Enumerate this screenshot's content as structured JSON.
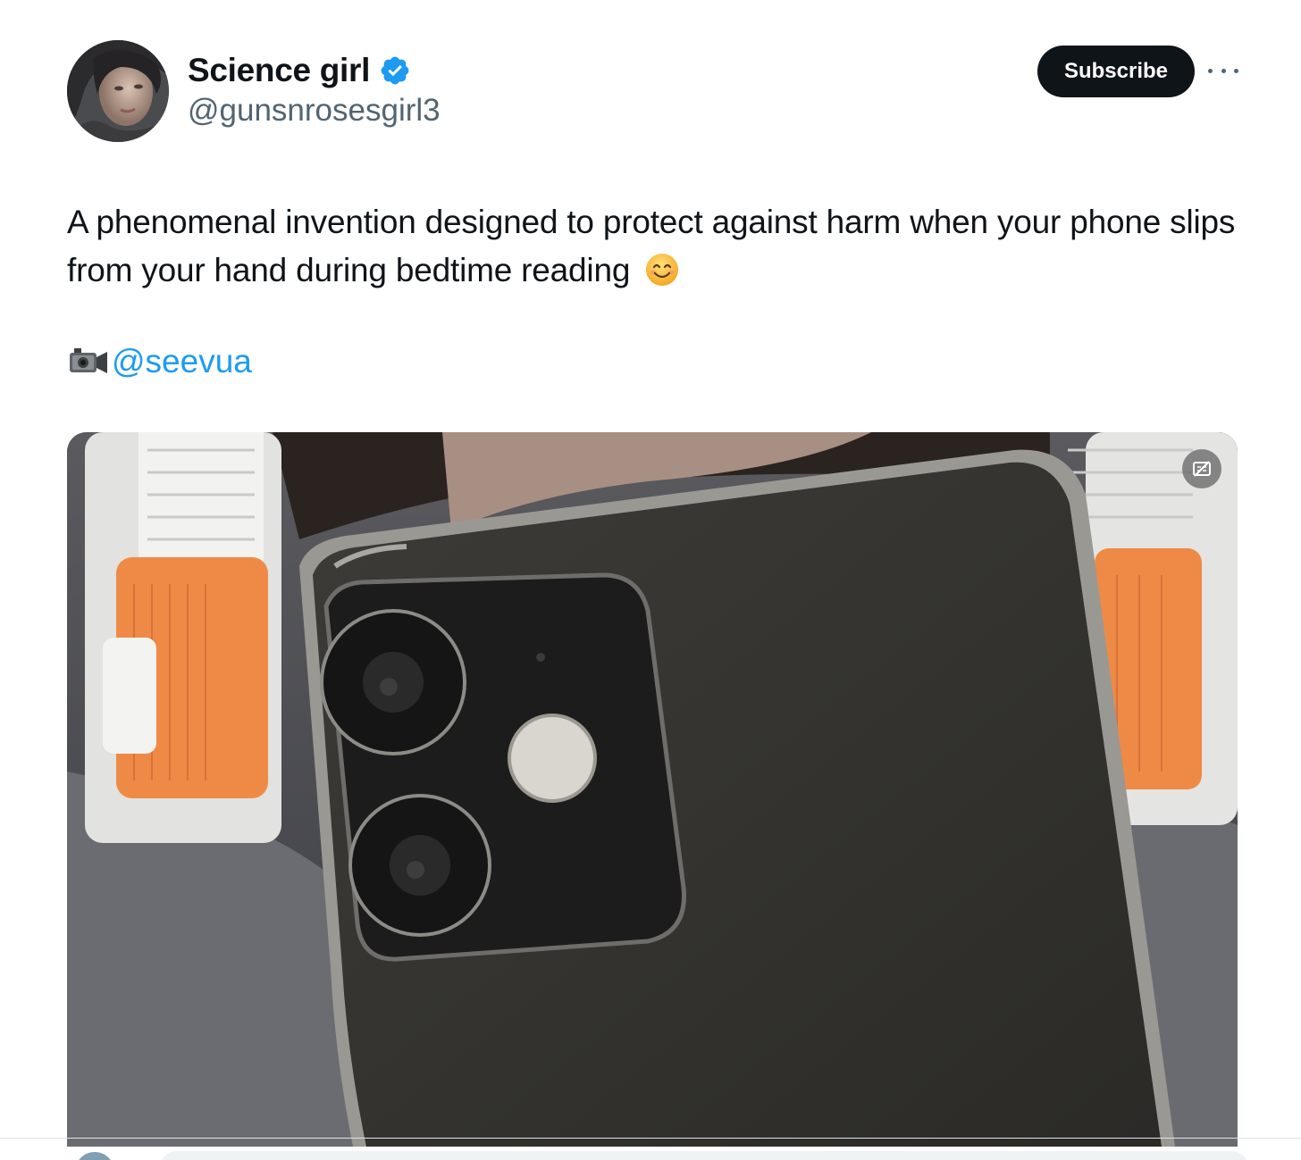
{
  "author": {
    "name": "Science girl",
    "handle": "@gunsnrosesgirl3",
    "verified": true,
    "avatar_icon": "profile-photo"
  },
  "actions": {
    "subscribe_label": "Subscribe",
    "more_icon": "more-horizontal-icon"
  },
  "tweet": {
    "text": "A phenomenal invention designed to protect against harm when your phone slips from your hand during bedtime reading",
    "emoji": "smiling-face-icon",
    "credit_icon": "video-camera-icon",
    "credit_mention": "@seevua"
  },
  "media": {
    "type": "video",
    "overlay_icon": "captions-off-icon"
  },
  "colors": {
    "text": "#0f1419",
    "secondary_text": "#536471",
    "link": "#1d9bf0",
    "verified": "#1d9bf0",
    "button_bg": "#0f1419"
  }
}
